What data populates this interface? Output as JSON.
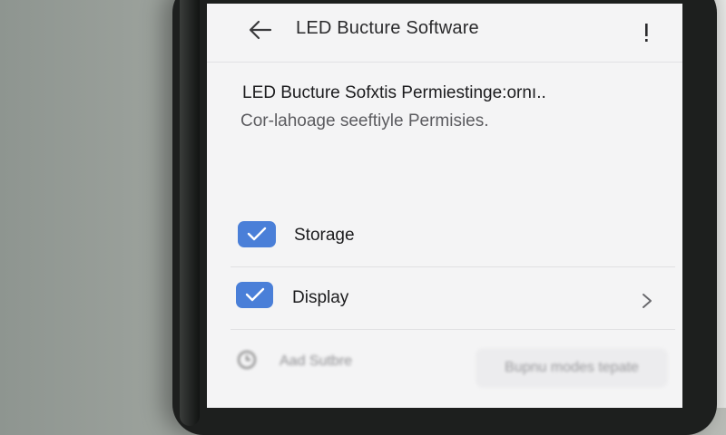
{
  "app_bar": {
    "back_icon": "arrow-left-icon",
    "title": "LED Bucture Software",
    "menu_icon": "more-vert-icon"
  },
  "permission_header": {
    "title": "LED Bucture Sofxtis Permiestinge:ornı..",
    "subtitle": "Cor-lahoage seeftiyle Permisies."
  },
  "permissions": [
    {
      "label": "Storage",
      "checked": true,
      "icon": "check-icon"
    },
    {
      "label": "Display",
      "checked": true,
      "icon": "check-icon",
      "trailing_icon": "chevron-right-icon"
    }
  ],
  "footer_row": {
    "icon": "history-icon",
    "label": "Aad Sutbre",
    "button_label": "Bupnu modes tepate"
  },
  "colors": {
    "accent": "#4a7fd8",
    "screen_bg": "#f4f4f5"
  }
}
